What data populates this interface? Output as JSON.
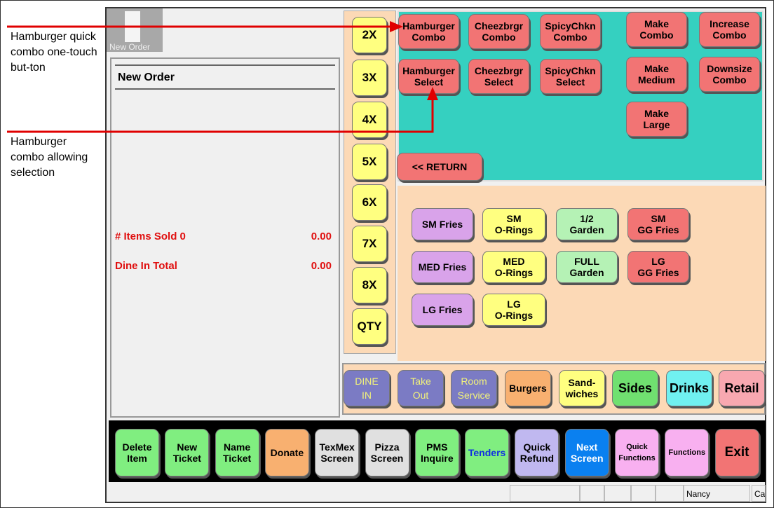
{
  "annotations": {
    "combo_note": "Hamburger quick combo one-touch but-ton",
    "select_note": "Hamburger combo allowing selection"
  },
  "thumbnail": {
    "label": "New Order"
  },
  "order_panel": {
    "title": "New Order",
    "items_sold_label": "# Items Sold 0",
    "items_sold_value": "0.00",
    "total_label": "Dine In Total",
    "total_value": "0.00"
  },
  "multipliers": [
    "2X",
    "3X",
    "4X",
    "5X",
    "6X",
    "7X",
    "8X",
    "QTY"
  ],
  "combo_buttons": [
    {
      "label": "Hamburger\nCombo"
    },
    {
      "label": "Cheezbrgr\nCombo"
    },
    {
      "label": "SpicyChkn\nCombo"
    },
    {
      "label": "Make\nCombo"
    },
    {
      "label": "Increase\nCombo"
    },
    {
      "label": "Hamburger\nSelect"
    },
    {
      "label": "Cheezbrgr\nSelect"
    },
    {
      "label": "SpicyChkn\nSelect"
    },
    {
      "label": "Make\nMedium"
    },
    {
      "label": "Downsize\nCombo"
    },
    {
      "label": "Make\nLarge"
    },
    {
      "label": "<< RETURN"
    }
  ],
  "side_buttons": [
    {
      "label": "SM Fries"
    },
    {
      "label": "SM\nO-Rings"
    },
    {
      "label": "1/2\nGarden"
    },
    {
      "label": "SM\nGG Fries"
    },
    {
      "label": "MED Fries"
    },
    {
      "label": "MED\nO-Rings"
    },
    {
      "label": "FULL\nGarden"
    },
    {
      "label": "LG\nGG Fries"
    },
    {
      "label": "LG Fries"
    },
    {
      "label": "LG\nO-Rings"
    }
  ],
  "categories": [
    {
      "label": "DINE\nIN"
    },
    {
      "label": "Take\nOut"
    },
    {
      "label": "Room\nService"
    },
    {
      "label": "Burgers"
    },
    {
      "label": "Sand-\nwiches"
    },
    {
      "label": "Sides"
    },
    {
      "label": "Drinks"
    },
    {
      "label": "Retail"
    }
  ],
  "functions": [
    {
      "label": "Delete\nItem"
    },
    {
      "label": "New\nTicket"
    },
    {
      "label": "Name\nTicket"
    },
    {
      "label": "Donate"
    },
    {
      "label": "TexMex\nScreen"
    },
    {
      "label": "Pizza\nScreen"
    },
    {
      "label": "PMS\nInquire"
    },
    {
      "label": "Tenders"
    },
    {
      "label": "Quick\nRefund"
    },
    {
      "label": "Next\nScreen"
    },
    {
      "label": "Quick\nFunctions"
    },
    {
      "label": "Functions"
    },
    {
      "label": "Exit"
    }
  ],
  "status": {
    "user": "Nancy",
    "extra": "Ca"
  },
  "colors": {
    "teal": "#35d0c0",
    "peach": "#fcd9b6",
    "annotation": "#e00000"
  }
}
